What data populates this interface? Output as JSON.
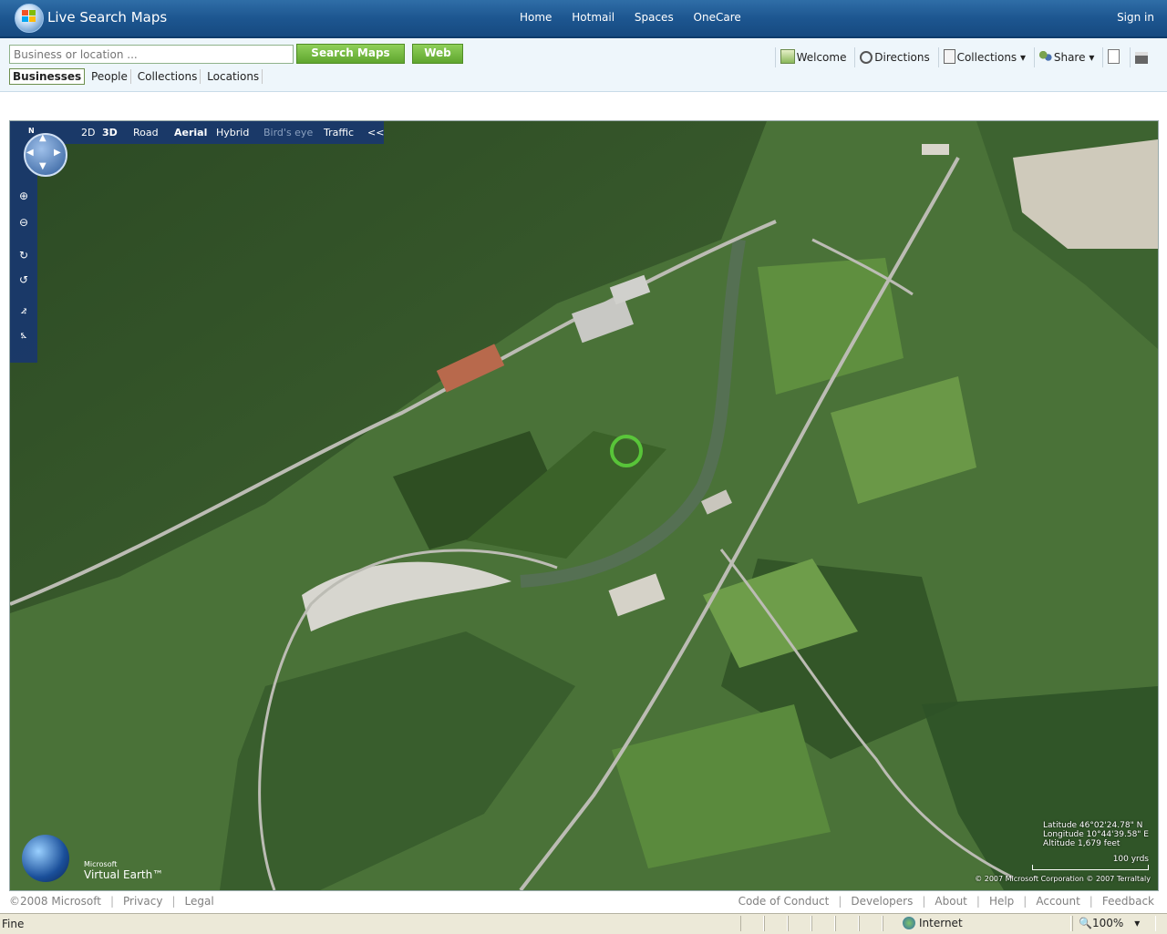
{
  "header": {
    "app_title": "Live Search Maps",
    "nav": [
      "Home",
      "Hotmail",
      "Spaces",
      "OneCare"
    ],
    "sign_in": "Sign in"
  },
  "search": {
    "placeholder": "Business or location ...",
    "search_button": "Search Maps",
    "web_button": "Web",
    "tabs": [
      "Businesses",
      "People",
      "Collections",
      "Locations"
    ],
    "active_tab": "Businesses"
  },
  "toolbar": {
    "welcome": "Welcome",
    "directions": "Directions",
    "collections": "Collections",
    "share": "Share"
  },
  "map": {
    "view_modes": {
      "d2": "2D",
      "d3": "3D",
      "road": "Road",
      "aerial": "Aerial",
      "hybrid": "Hybrid",
      "birdseye": "Bird's eye",
      "traffic": "Traffic",
      "collapse": "<<"
    },
    "selected_style": "Aerial",
    "compass_north": "N",
    "latitude": "Latitude 46°02'24.78\" N",
    "longitude": "Longitude 10°44'39.58\" E",
    "altitude": "Altitude 1,679 feet",
    "scale_label": "100 yrds",
    "copyright": "© 2007 Microsoft Corporation  © 2007 TerraItaly",
    "brand_small": "Microsoft",
    "brand_name": "Virtual Earth™"
  },
  "footer": {
    "copyright": "©2008 Microsoft",
    "left_links": [
      "Privacy",
      "Legal"
    ],
    "right_links": [
      "Code of Conduct",
      "Developers",
      "About",
      "Help",
      "Account",
      "Feedback"
    ]
  },
  "statusbar": {
    "status": "Fine",
    "zone": "Internet",
    "zoom": "100%"
  }
}
